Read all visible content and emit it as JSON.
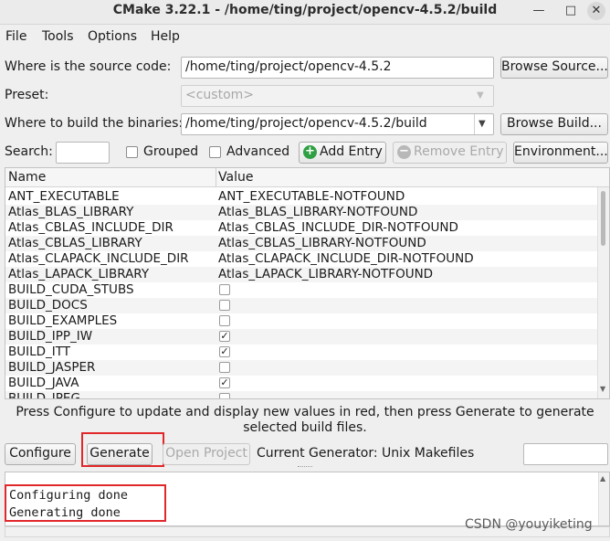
{
  "window": {
    "title": "CMake 3.22.1 - /home/ting/project/opencv-4.5.2/build",
    "minimize": "—",
    "maximize": "□",
    "close": "✕"
  },
  "menu": [
    "File",
    "Tools",
    "Options",
    "Help"
  ],
  "source": {
    "label": "Where is the source code:",
    "value": "/home/ting/project/opencv-4.5.2",
    "browse": "Browse Source..."
  },
  "preset": {
    "label": "Preset:",
    "value": "<custom>"
  },
  "build": {
    "label": "Where to build the binaries:",
    "value": "/home/ting/project/opencv-4.5.2/build",
    "browse": "Browse Build..."
  },
  "search": {
    "label": "Search:",
    "value": ""
  },
  "options": {
    "grouped": "Grouped",
    "advanced": "Advanced",
    "add_entry": "Add Entry",
    "remove_entry": "Remove Entry",
    "environment": "Environment..."
  },
  "table": {
    "headers": [
      "Name",
      "Value"
    ],
    "rows": [
      {
        "name": "ANT_EXECUTABLE",
        "value": "ANT_EXECUTABLE-NOTFOUND"
      },
      {
        "name": "Atlas_BLAS_LIBRARY",
        "value": "Atlas_BLAS_LIBRARY-NOTFOUND"
      },
      {
        "name": "Atlas_CBLAS_INCLUDE_DIR",
        "value": "Atlas_CBLAS_INCLUDE_DIR-NOTFOUND"
      },
      {
        "name": "Atlas_CBLAS_LIBRARY",
        "value": "Atlas_CBLAS_LIBRARY-NOTFOUND"
      },
      {
        "name": "Atlas_CLAPACK_INCLUDE_DIR",
        "value": "Atlas_CLAPACK_INCLUDE_DIR-NOTFOUND"
      },
      {
        "name": "Atlas_LAPACK_LIBRARY",
        "value": "Atlas_LAPACK_LIBRARY-NOTFOUND"
      },
      {
        "name": "BUILD_CUDA_STUBS",
        "checked": false
      },
      {
        "name": "BUILD_DOCS",
        "checked": false
      },
      {
        "name": "BUILD_EXAMPLES",
        "checked": false
      },
      {
        "name": "BUILD_IPP_IW",
        "checked": true
      },
      {
        "name": "BUILD_ITT",
        "checked": true
      },
      {
        "name": "BUILD_JASPER",
        "checked": false
      },
      {
        "name": "BUILD_JAVA",
        "checked": true
      },
      {
        "name": "BUILD_JPEG",
        "checked": false
      }
    ]
  },
  "info_text": "Press Configure to update and display new values in red, then press Generate to generate selected build files.",
  "actions": {
    "configure": "Configure",
    "generate": "Generate",
    "open_project": "Open Project",
    "generator": "Current Generator: Unix Makefiles"
  },
  "output_lines": [
    "Configuring done",
    "Generating done"
  ],
  "watermark": "CSDN @youyiketing"
}
